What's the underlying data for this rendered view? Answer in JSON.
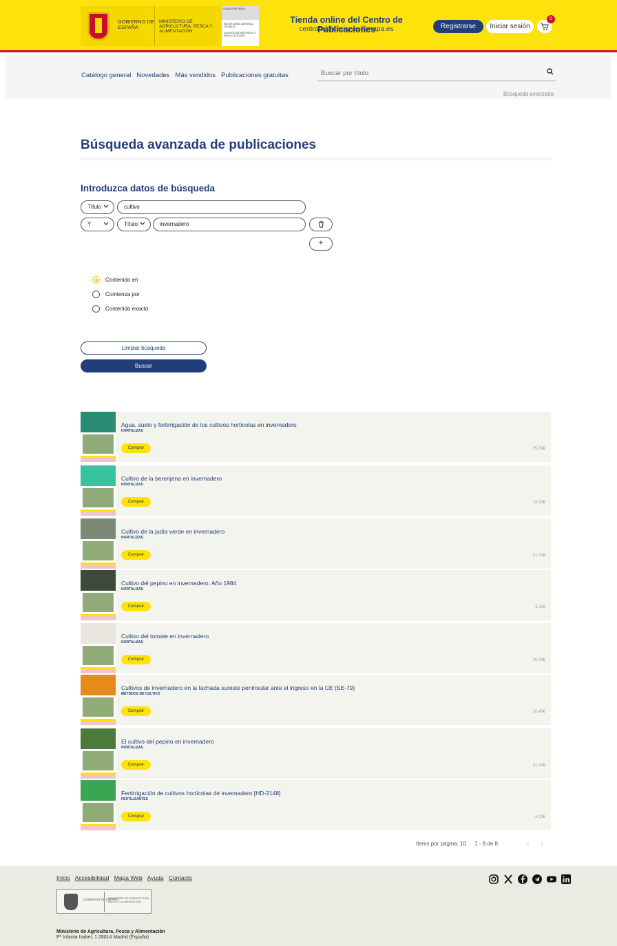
{
  "header": {
    "gov_label": "GOBIERNO DE ESPAÑA",
    "ministry_label": "MINISTERIO DE AGRICULTURA, PESCA Y ALIMENTACIÓN",
    "sub_head": "SUBSECRETARÍA",
    "sub_line1": "SECRETARÍA GENERAL TÉCNICA",
    "sub_line2": "DIVISIÓN DE ARCHIVOS Y PUBLICACIONES",
    "store_title": "Tienda online del Centro de Publicaciones",
    "store_email": "centropublicaciones@mapa.es",
    "register_label": "Registrarse",
    "login_label": "Iniciar sesión",
    "cart_count": "0"
  },
  "nav": {
    "items": [
      "Catálogo general",
      "Novedades",
      "Más vendidos",
      "Publicaciones gratuitas"
    ],
    "search_placeholder": "Buscar por título",
    "advanced_link": "Búsqueda avanzada"
  },
  "form": {
    "page_title": "Búsqueda avanzada de publicaciones",
    "section_title": "Introduzca datos de búsqueda",
    "row1": {
      "field": "Título",
      "value": "cultivo"
    },
    "row2": {
      "operator": "Y",
      "field": "Título",
      "value": "invernadero"
    },
    "add_label": "+",
    "match_options": [
      {
        "label": "Contenido en",
        "selected": true
      },
      {
        "label": "Comienza por",
        "selected": false
      },
      {
        "label": "Contenido exacto",
        "selected": false
      }
    ],
    "clear_label": "Limpiar búsqueda",
    "search_label": "Buscar"
  },
  "results": {
    "buy_label": "Comprar",
    "items": [
      {
        "title": "Agua, suelo y fertirrigación de los cultivos hortícolas en invernadero",
        "category": "HORTALIZAS",
        "price": "25.00€",
        "cover": "#2b8a73"
      },
      {
        "title": "Cultivo de la berenjena en invernadero",
        "category": "HORTALIZAS",
        "price": "13.22€",
        "cover": "#39c2a0"
      },
      {
        "title": "Cultivo de la judía verde en invernadero",
        "category": "HORTALIZAS",
        "price": "21.00€",
        "cover": "#7a8a74"
      },
      {
        "title": "Cultivo del pepino en invernadero. Año 1984",
        "category": "HORTALIZAS",
        "price": "5.11€",
        "cover": "#3d4a3a"
      },
      {
        "title": "Cultivo del tomate en invernadero",
        "category": "HORTALIZAS",
        "price": "20.00€",
        "cover": "#e9e6e0"
      },
      {
        "title": "Cultivos de invernadero en la fachada sureste peninsular ante el ingreso en la CE (SE-79)",
        "category": "MÉTODOS DE CULTIVO",
        "price": "20.43€",
        "cover": "#e68a1c"
      },
      {
        "title": "El cultivo del pepino en invernadero",
        "category": "HORTALIZAS",
        "price": "21.00€",
        "cover": "#4d7a3a"
      },
      {
        "title": "Fertirrigación de cultivos hortícolas de invernadero [HD-2148]",
        "category": "FERTILIZANTES",
        "price": "4.00€",
        "cover": "#3aa552"
      }
    ]
  },
  "pager": {
    "items_per_page": "Items por página: 10",
    "range": "1 - 8 de 8"
  },
  "footer": {
    "links": [
      "Inicio",
      "Accesibilidad",
      "Mapa Web",
      "Ayuda",
      "Contacto"
    ],
    "org_name": "Ministerio de Agricultura, Pesca y Alimentación",
    "address": "Pº Infanta Isabel, 1 28014 Madrid (España)",
    "gov_label": "GOBIERNO DE ESPAÑA",
    "ministry_label": "MINISTERIO DE AGRICULTURA, PESCA Y ALIMENTACIÓN",
    "social_icons": [
      "instagram-icon",
      "x-icon",
      "facebook-icon",
      "telegram-icon",
      "youtube-icon",
      "linkedin-icon"
    ]
  }
}
